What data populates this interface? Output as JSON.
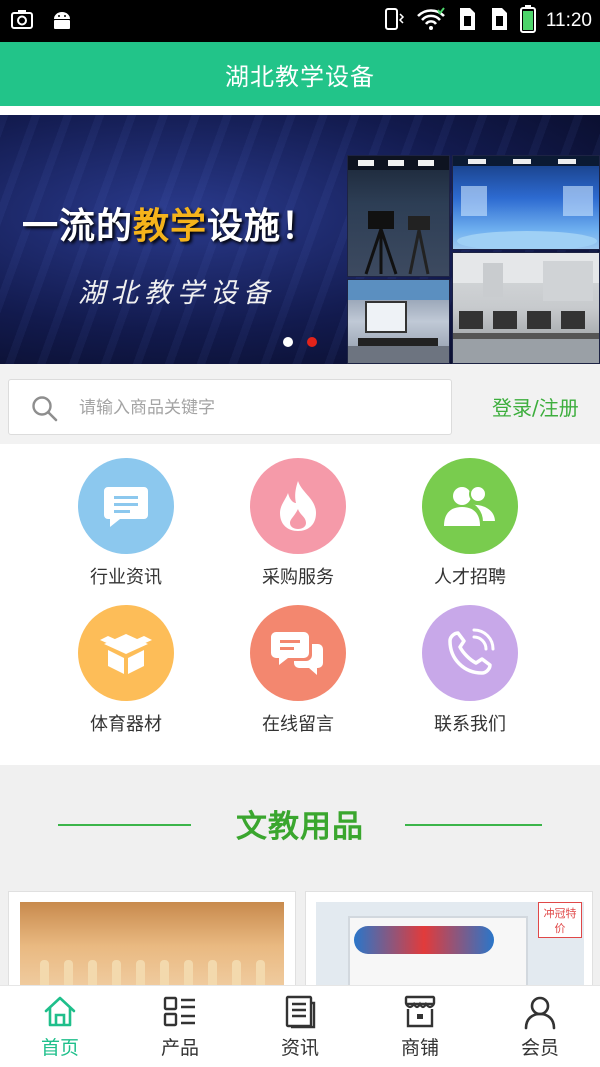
{
  "status_bar": {
    "time": "11:20",
    "left_icons": [
      "screenshot-icon",
      "android-icon"
    ],
    "right_icons": [
      "vibrate-icon",
      "wifi-icon",
      "sim1-icon",
      "sim2-icon",
      "battery-icon"
    ]
  },
  "header": {
    "title": "湖北教学设备"
  },
  "banner": {
    "headline_pre": "一流的",
    "headline_highlight": "教学",
    "headline_post": "设施！",
    "subtitle": "湖北教学设备",
    "slide_count": 2,
    "active_slide": 2
  },
  "search": {
    "placeholder": "请输入商品关键字",
    "value": ""
  },
  "auth": {
    "label": "登录/注册"
  },
  "categories": [
    {
      "label": "行业资讯",
      "icon": "message-icon",
      "color": "#8cc8ee"
    },
    {
      "label": "采购服务",
      "icon": "fire-icon",
      "color": "#f59aa9"
    },
    {
      "label": "人才招聘",
      "icon": "people-icon",
      "color": "#79cc4e"
    },
    {
      "label": "体育器材",
      "icon": "box-icon",
      "color": "#fdbd58"
    },
    {
      "label": "在线留言",
      "icon": "chat-icon",
      "color": "#f3876f"
    },
    {
      "label": "联系我们",
      "icon": "phone-icon",
      "color": "#c8a8e9"
    }
  ],
  "section": {
    "title": "文教用品"
  },
  "products": [
    {
      "icon": "abacus-image"
    },
    {
      "icon": "letter-number-board-image",
      "badge": "冲冠特价"
    }
  ],
  "bottom_nav": [
    {
      "label": "首页",
      "icon": "home-icon",
      "active": true
    },
    {
      "label": "产品",
      "icon": "grid-list-icon",
      "active": false
    },
    {
      "label": "资讯",
      "icon": "news-icon",
      "active": false
    },
    {
      "label": "商铺",
      "icon": "store-icon",
      "active": false
    },
    {
      "label": "会员",
      "icon": "user-icon",
      "active": false
    }
  ],
  "colors": {
    "brand": "#22c489",
    "section_green": "#3aa62e",
    "nav_active": "#1fbf8b",
    "dot_active": "#e2231a"
  }
}
